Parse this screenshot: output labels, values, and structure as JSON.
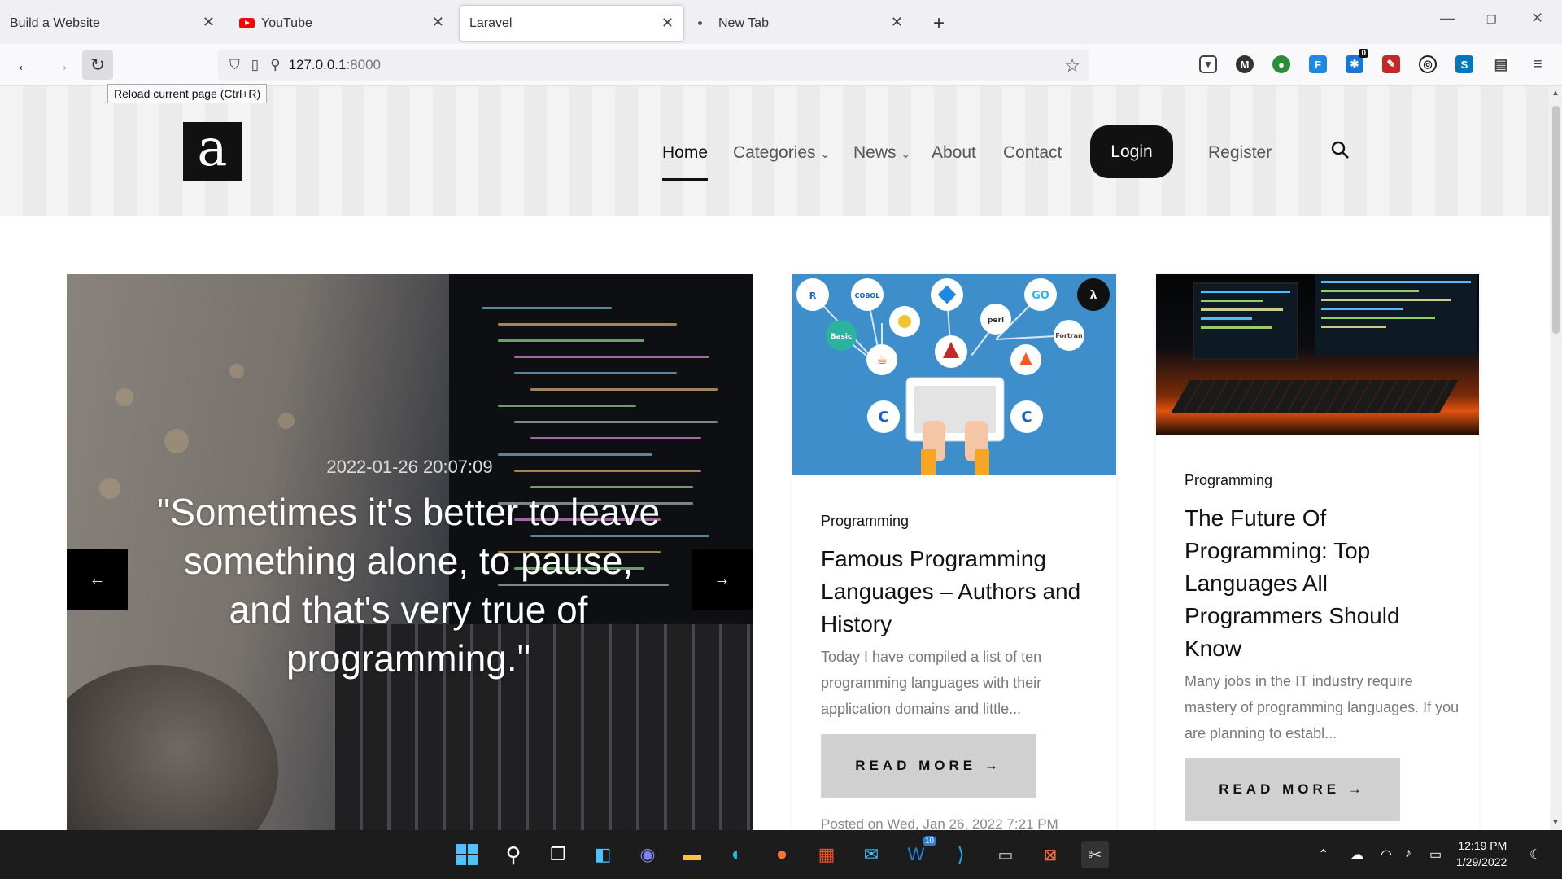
{
  "tabs": [
    {
      "label": "Build a Website"
    },
    {
      "label": "YouTube"
    },
    {
      "label": "Laravel"
    },
    {
      "label": "New Tab"
    }
  ],
  "toolbar": {
    "url_host": "127.0.0.1",
    "url_port": ":8000",
    "tooltip": "Reload current page (Ctrl+R)"
  },
  "site": {
    "logo": "a",
    "nav": {
      "home": "Home",
      "categories": "Categories",
      "news": "News",
      "about": "About",
      "contact": "Contact",
      "login": "Login",
      "register": "Register"
    }
  },
  "hero": {
    "date": "2022-01-26 20:07:09",
    "quote": "\"Sometimes it's better to leave something alone, to pause, and that's very true of programming.\"",
    "prev_icon": "arrow-left-icon",
    "next_icon": "arrow-right-icon"
  },
  "cards": [
    {
      "category": "Programming",
      "title": "Famous Programming Languages – Authors and History",
      "excerpt": "Today I have compiled a list of ten programming languages with their application domains and little...",
      "read_more": "READ MORE →",
      "posted": "Posted on Wed, Jan 26, 2022 7:21 PM",
      "image_labels": [
        "R",
        "COBOL",
        "Basic",
        "perl",
        "GO",
        "Fortran"
      ]
    },
    {
      "category": "Programming",
      "title": "The Future Of Programming: Top Languages All Programmers Should Know",
      "excerpt": "Many jobs in the IT industry require mastery of programming languages. If you are planning to establ...",
      "read_more": "READ MORE →"
    }
  ],
  "taskbar": {
    "time": "12:19 PM",
    "date": "1/29/2022",
    "badge": "10"
  },
  "extensions": {
    "badge": "0"
  },
  "colors": {
    "accent": "#111111",
    "header_stripe": "#ebebeb",
    "read_more_bg": "#d0d0d0"
  }
}
